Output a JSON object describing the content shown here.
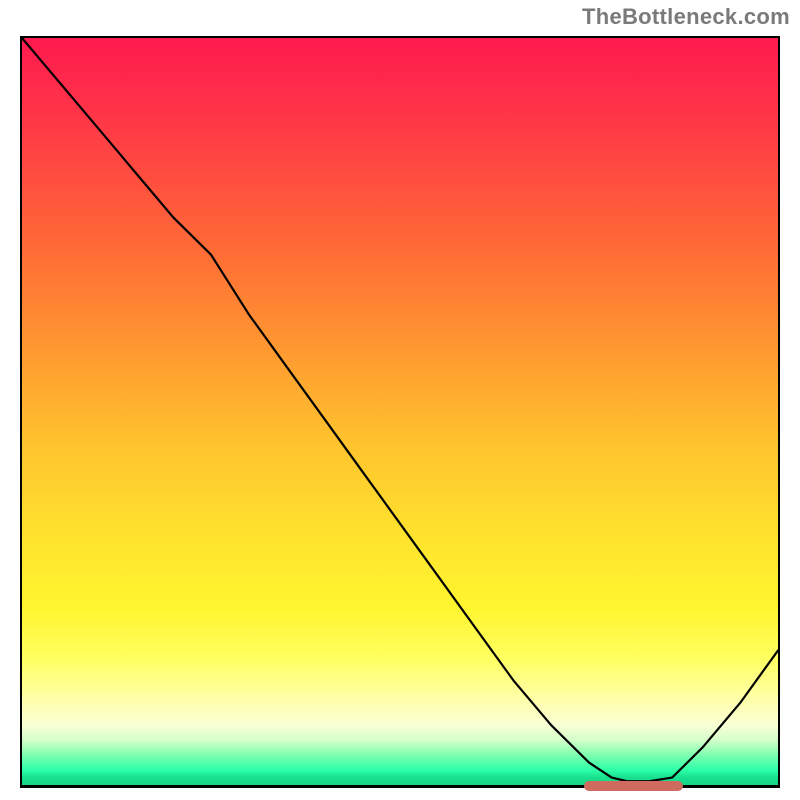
{
  "watermark": "TheBottleneck.com",
  "chart_data": {
    "type": "line",
    "title": "",
    "xlabel": "",
    "ylabel": "",
    "xlim": [
      0,
      100
    ],
    "ylim": [
      0,
      100
    ],
    "grid": false,
    "legend": false,
    "series": [
      {
        "name": "bottleneck-curve",
        "x": [
          0,
          5,
          10,
          15,
          20,
          25,
          30,
          35,
          40,
          45,
          50,
          55,
          60,
          65,
          70,
          75,
          78,
          80,
          83,
          86,
          90,
          95,
          100
        ],
        "values": [
          100,
          94,
          88,
          82,
          76,
          71,
          63,
          56,
          49,
          42,
          35,
          28,
          21,
          14,
          8,
          3,
          1,
          0.5,
          0.5,
          1,
          5,
          11,
          18
        ]
      }
    ],
    "annotations": [
      {
        "name": "optimal-range",
        "x_start": 74,
        "x_end": 87,
        "y": 0.5,
        "color": "#cf6a5e"
      }
    ],
    "background_gradient": {
      "direction": "vertical",
      "stops": [
        {
          "pos": 0.0,
          "color": "#ff1a4f"
        },
        {
          "pos": 0.5,
          "color": "#ffc22e"
        },
        {
          "pos": 0.8,
          "color": "#ffff60"
        },
        {
          "pos": 0.94,
          "color": "#d4ffca"
        },
        {
          "pos": 1.0,
          "color": "#15d686"
        }
      ]
    }
  }
}
